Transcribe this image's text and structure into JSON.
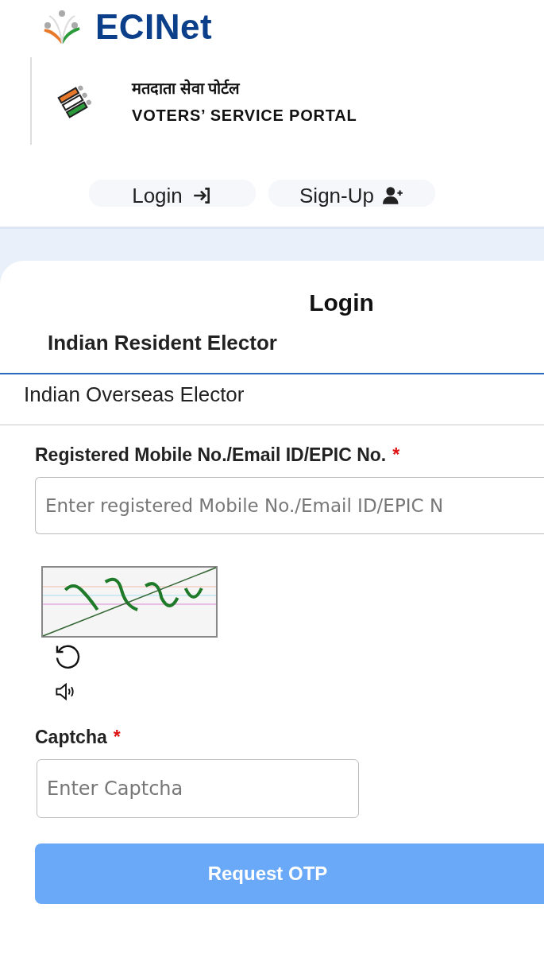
{
  "header": {
    "brand": "ECINet",
    "portal_hindi": "मतदाता सेवा पोर्टल",
    "portal_english": "VOTERS’ SERVICE PORTAL"
  },
  "nav": [
    {
      "label": "Login",
      "kind": "login"
    },
    {
      "label": "Sign-Up",
      "kind": "signup"
    }
  ],
  "card": {
    "title": "Login",
    "tabs": [
      {
        "label": "Indian Resident Elector",
        "selected": true
      },
      {
        "label": "Indian Overseas Elector",
        "selected": false
      }
    ],
    "id_field": {
      "label": "Registered Mobile No./Email ID/EPIC No.",
      "required": true,
      "required_mark": "*",
      "placeholder": "Enter registered Mobile No./Email ID/EPIC N"
    },
    "captcha_field": {
      "label": "Captcha",
      "required": true,
      "required_mark": "*",
      "placeholder": "Enter Captcha"
    },
    "submit": {
      "label": "Request OTP",
      "disabled": true
    }
  }
}
